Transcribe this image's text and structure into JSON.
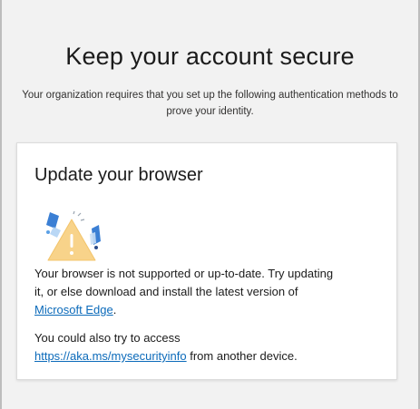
{
  "page": {
    "title": "Keep your account secure",
    "subtitle": "Your organization requires that you set up the following authentication methods to prove your identity."
  },
  "card": {
    "title": "Update your browser",
    "illustration_icon": "warning-triangle-icon",
    "message_part1": "Your browser is not supported or up-to-date. Try updating it, or else download and install the latest version of ",
    "edge_link": "Microsoft Edge",
    "message_part2": ".",
    "alt_part1": "You could also try to access ",
    "alt_link": "https://aka.ms/mysecurityinfo",
    "alt_part2": " from another device."
  },
  "colors": {
    "background": "#f2f2f2",
    "card": "#ffffff",
    "link": "#0b6aba",
    "warning": "#f8d38a",
    "accent_blue": "#3b7fd4"
  }
}
